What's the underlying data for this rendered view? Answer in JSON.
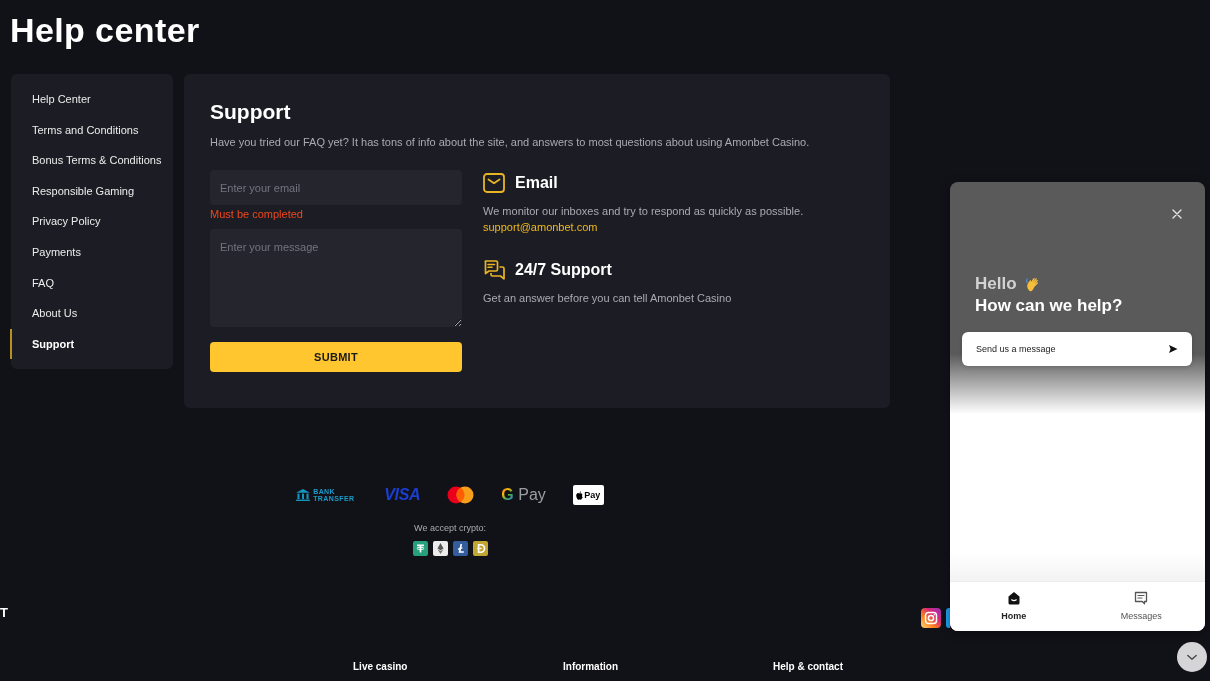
{
  "page": {
    "title": "Help center"
  },
  "sidebar": {
    "items": [
      {
        "label": "Help Center",
        "selected": false
      },
      {
        "label": "Terms and Conditions",
        "selected": false
      },
      {
        "label": "Bonus Terms & Conditions",
        "selected": false
      },
      {
        "label": "Responsible Gaming",
        "selected": false
      },
      {
        "label": "Privacy Policy",
        "selected": false
      },
      {
        "label": "Payments",
        "selected": false
      },
      {
        "label": "FAQ",
        "selected": false
      },
      {
        "label": "About Us",
        "selected": false
      },
      {
        "label": "Support",
        "selected": true
      }
    ]
  },
  "support": {
    "title": "Support",
    "intro": "Have you tried our FAQ yet? It has tons of info about the site, and answers to most questions about using Amonbet Casino.",
    "form": {
      "email": {
        "placeholder": "Enter your email",
        "error": "Must be completed"
      },
      "message": {
        "placeholder": "Enter your message"
      },
      "submit": "SUBMIT"
    },
    "contacts": [
      {
        "kind": "email",
        "title": "Email",
        "text": "We monitor our inboxes and try to respond as quickly as possible.",
        "link": "support@amonbet.com"
      },
      {
        "kind": "chat",
        "title": "24/7 Support",
        "text": "Get an answer before you can tell Amonbet Casino"
      }
    ]
  },
  "payments": {
    "methods": [
      {
        "kind": "bank",
        "label": "BANK TRANSFER"
      },
      {
        "kind": "visa",
        "label": "VISA"
      },
      {
        "kind": "mastercard"
      },
      {
        "kind": "gpay",
        "mark": "G",
        "label": "Pay"
      },
      {
        "kind": "applepay",
        "label": "Pay"
      }
    ],
    "crypto_label": "We accept crypto:",
    "coins": [
      {
        "kind": "tether",
        "color": "#26a17b"
      },
      {
        "kind": "ether",
        "color": "#ececec"
      },
      {
        "kind": "litecoin",
        "color": "#345d9d"
      },
      {
        "kind": "doge",
        "color": "#c2a633"
      }
    ]
  },
  "footer": {
    "brand_text": "T",
    "columns": [
      "Live casino",
      "Information",
      "Help & contact"
    ]
  },
  "chat_widget": {
    "greeting": "Hello",
    "headline": "How can we help?",
    "send_label": "Send us a message",
    "tabs": [
      {
        "kind": "home",
        "label": "Home",
        "selected": true
      },
      {
        "kind": "messages",
        "label": "Messages",
        "selected": false
      }
    ]
  }
}
